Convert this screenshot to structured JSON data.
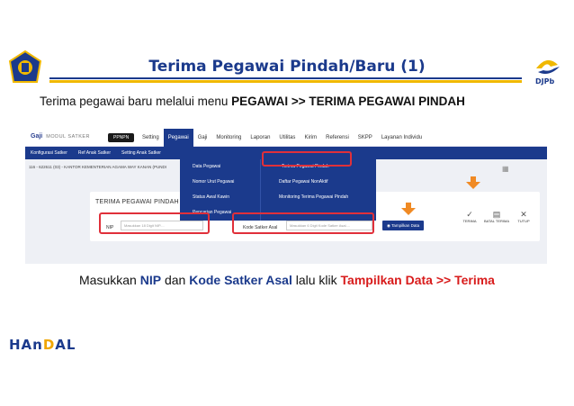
{
  "header": {
    "title": "Terima Pegawai Pindah/Baru (1)",
    "logo_right_text": "DJPb"
  },
  "intro": {
    "prefix": "Terima pegawai baru melalui menu ",
    "bold": "PEGAWAI >> TERIMA PEGAWAI PINDAH"
  },
  "app": {
    "brand": "Gaji",
    "module": "MODUL SATKER",
    "badge": "PPNPN",
    "topnav": [
      "Setting",
      "Pegawai",
      "Gaji",
      "Monitoring",
      "Laporan",
      "Utilitas",
      "Kirim",
      "Referensi",
      "SKPP",
      "Layanan Individu"
    ],
    "subnav": [
      "Konfigurasi Satker",
      "Ref Anak Satker",
      "Setting Anak Satker"
    ],
    "breadcrumb": "116 - 622611 (03) - KANTOR KEMENTERIAN AGAMA WAY KANAN (PUNDI",
    "card_title": "TERIMA PEGAWAI PINDAH",
    "nip_label": "NIP",
    "nip_placeholder": "Masukkan 18 Digit NIP....",
    "ksa_label": "Kode Satker Asal",
    "ksa_placeholder": "Masukkan 6 Digit Kode Satker Asal....",
    "show_button": "Tampilkan Data",
    "actions": [
      {
        "icon": "check-icon",
        "label": "TERIMA"
      },
      {
        "icon": "trash-icon",
        "label": "BATAL TERIMA"
      },
      {
        "icon": "close-icon",
        "label": "TUTUP"
      }
    ],
    "dropdown_left": [
      "Data Pegawai",
      "Nomor Urut Pegawai",
      "Status Awal Kawin",
      "Pencarian Pegawai"
    ],
    "dropdown_right": [
      "Terima Pegawai Pindah",
      "Daftar Pegawai NonAktif",
      "Monitoring Terima Pegawai Pindah"
    ]
  },
  "instruction": {
    "p1": "Masukkan ",
    "nip": "NIP",
    "p2": " dan ",
    "ksa": "Kode Satker Asal",
    "p3": " lalu klik ",
    "action": "Tampilkan Data >> Terima"
  },
  "footer": {
    "brand_a": "HAn",
    "brand_b": "D",
    "brand_c": "AL"
  },
  "colors": {
    "primary": "#1b3a8c",
    "accent_gold": "#f0b800",
    "highlight_red": "#e0303a",
    "arrow_orange": "#f08a24"
  }
}
